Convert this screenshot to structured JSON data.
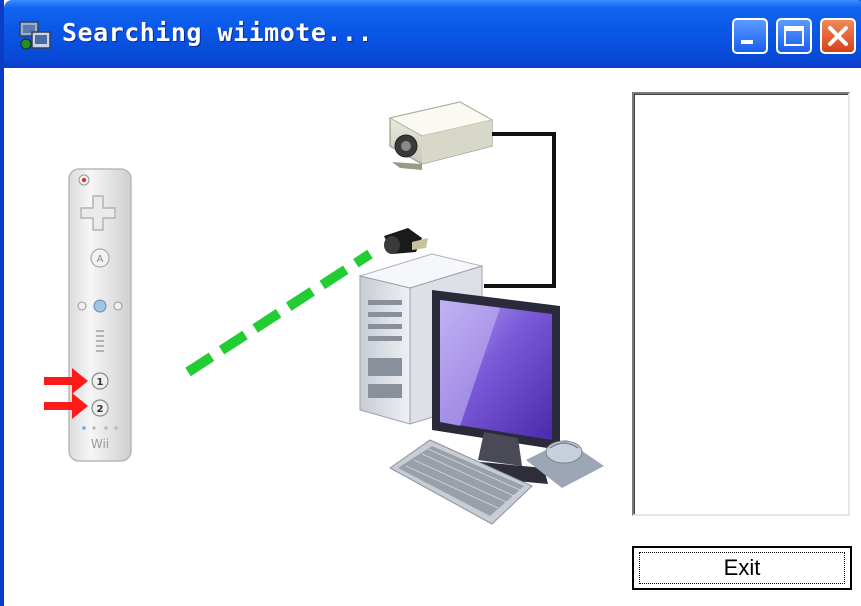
{
  "window": {
    "title": "Searching wiimote...",
    "app_icon": "wiimote-app-icon"
  },
  "title_buttons": [
    "minimize-icon",
    "maximize-icon",
    "close-icon"
  ],
  "illustration": {
    "wiimote_brand": "Wii",
    "button_1": "1",
    "button_2": "2"
  },
  "exit_button": {
    "label": "Exit"
  },
  "colors": {
    "titlebar": "#0a55e6",
    "signal": "#22cc33",
    "arrow": "#ff1a1a",
    "monitor_screen": "#7a5ad8"
  }
}
